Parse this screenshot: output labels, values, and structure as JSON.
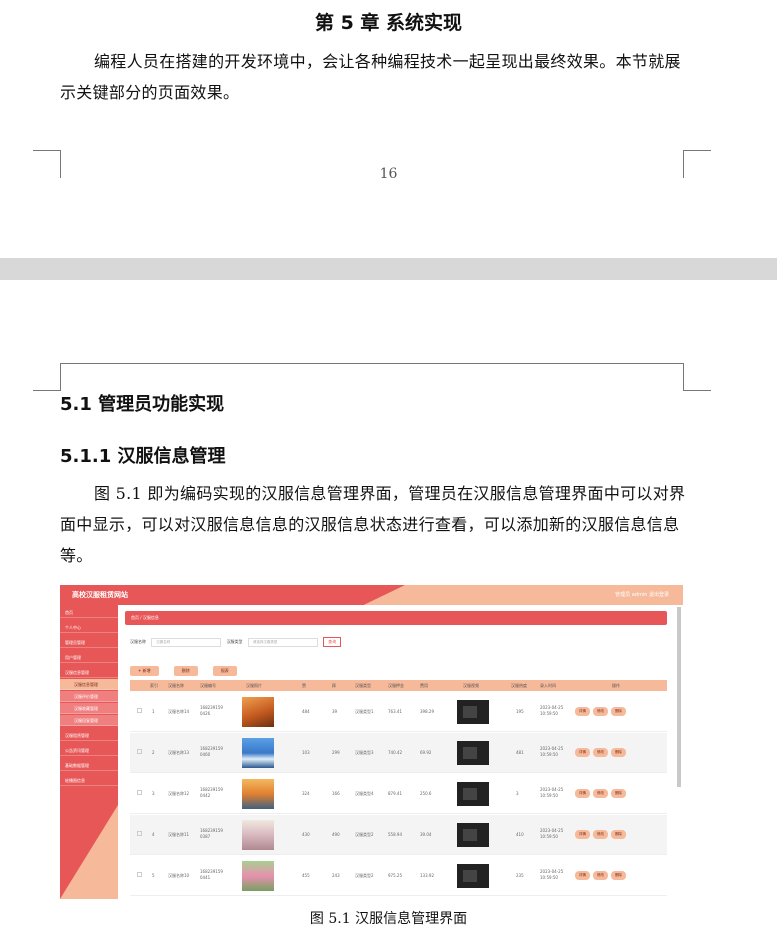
{
  "top_page": {
    "chapter_title": "第 5 章  系统实现",
    "intro": "编程人员在搭建的开发环境中，会让各种编程技术一起呈现出最终效果。本节就展示关键部分的页面效果。",
    "page_number": "16"
  },
  "bottom_page": {
    "h2": "5.1  管理员功能实现",
    "h3": "5.1.1  汉服信息管理",
    "body": "图 5.1  即为编码实现的汉服信息管理界面，管理员在汉服信息管理界面中可以对界面中显示，可以对汉服信息信息的汉服信息状态进行查看，可以添加新的汉服信息信息等。",
    "caption": "图 5.1 汉服信息管理界面"
  },
  "screenshot": {
    "logo": "高校汉服租赁网站",
    "user": "管理员 admin    退出登录",
    "breadcrumb": "首页 / 汉服信息",
    "sidebar": [
      "首页",
      "个人中心",
      "管理员管理",
      "用户管理",
      "汉服信息管理",
      "汉服信息管理",
      "汉服评价管理",
      "汉服收藏管理",
      "汉服回复管理",
      "汉服租赁管理",
      "公告资讯管理",
      "基础数据管理",
      "轮播图信息"
    ],
    "search": {
      "label1": "汉服名称",
      "placeholder1": "汉服名称",
      "label2": "汉服类型",
      "placeholder2": "请选择汉服类型",
      "button": "查询"
    },
    "buttons": [
      "+ 新增",
      "删除",
      "报表"
    ],
    "columns": [
      "索引",
      "汉服名称",
      "汉服编号",
      "汉服照片",
      "赞",
      "踩",
      "汉服类型",
      "汉服押金",
      "费用",
      "汉服视频",
      "汉服热度",
      "录入时间",
      "操作"
    ],
    "rows": [
      {
        "idx": "1",
        "name": "汉服名称14",
        "code": "1682391590426",
        "zan": "484",
        "cai": "39",
        "type": "汉服类型1",
        "deposit": "763.41",
        "fee": "398.29",
        "heat": "195",
        "time": "2023-04-25 10:59:50"
      },
      {
        "idx": "2",
        "name": "汉服名称13",
        "code": "1682391590460",
        "zan": "103",
        "cai": "299",
        "type": "汉服类型3",
        "deposit": "740.42",
        "fee": "69.92",
        "heat": "481",
        "time": "2023-04-25 10:59:50"
      },
      {
        "idx": "3",
        "name": "汉服名称12",
        "code": "1682391590442",
        "zan": "324",
        "cai": "166",
        "type": "汉服类型4",
        "deposit": "879.41",
        "fee": "250.6",
        "heat": "3",
        "time": "2023-04-25 10:59:50"
      },
      {
        "idx": "4",
        "name": "汉服名称11",
        "code": "1682391590387",
        "zan": "430",
        "cai": "490",
        "type": "汉服类型2",
        "deposit": "558.94",
        "fee": "39.04",
        "heat": "410",
        "time": "2023-04-25 10:59:50"
      },
      {
        "idx": "5",
        "name": "汉服名称10",
        "code": "1682391590441",
        "zan": "455",
        "cai": "243",
        "type": "汉服类型2",
        "deposit": "975.25",
        "fee": "133.92",
        "heat": "235",
        "time": "2023-04-25 10:59:50"
      }
    ],
    "ops": [
      "详情",
      "修改",
      "删除"
    ]
  }
}
